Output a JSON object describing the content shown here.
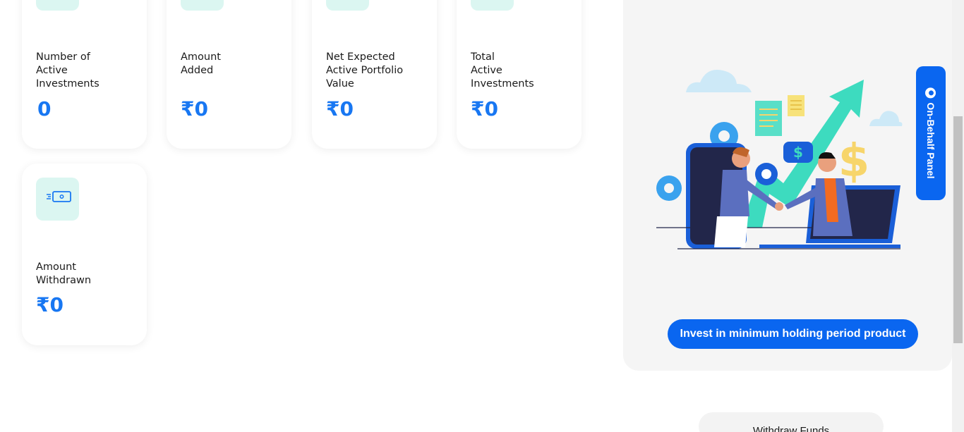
{
  "cards": [
    {
      "label_lines": [
        "Number of",
        "Active",
        "Investments"
      ],
      "value": "0"
    },
    {
      "label_lines": [
        "Amount",
        "Added"
      ],
      "value": "₹0"
    },
    {
      "label_lines": [
        "Net Expected",
        "Active Portfolio",
        "Value"
      ],
      "value": "₹0"
    },
    {
      "label_lines": [
        "Total",
        "Active",
        "Investments"
      ],
      "value": "₹0"
    },
    {
      "label_lines": [
        "Amount",
        "Withdrawn"
      ],
      "value": "₹0"
    }
  ],
  "panel": {
    "illustration_icon": "business-handshake-growth",
    "invest_button": "Invest in minimum holding period product"
  },
  "on_behalf_panel": {
    "label": "On-Behalf Panel",
    "icon": "user-circle-icon"
  },
  "withdraw_button": "Withdraw Funds",
  "colors": {
    "accent": "#0a66f0",
    "value_blue": "#1877f2",
    "icon_bg": "#dbf6f1",
    "panel_bg": "#f5f5f5"
  }
}
